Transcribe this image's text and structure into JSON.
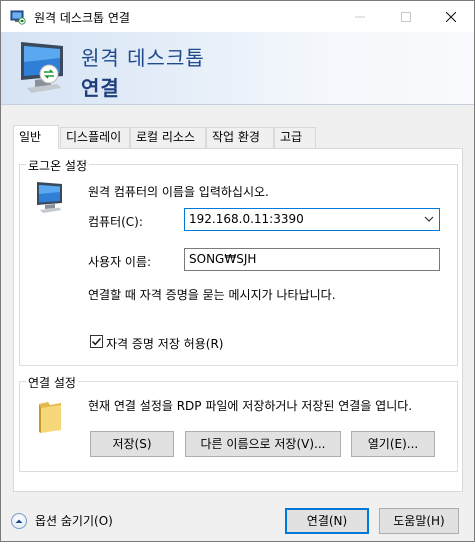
{
  "window": {
    "title": "원격 데스크톱 연결"
  },
  "banner": {
    "title": "원격 데스크톱",
    "subtitle": "연결"
  },
  "tabs": [
    {
      "label": "일반",
      "active": true
    },
    {
      "label": "디스플레이",
      "active": false
    },
    {
      "label": "로컬 리소스",
      "active": false
    },
    {
      "label": "작업 환경",
      "active": false
    },
    {
      "label": "고급",
      "active": false
    }
  ],
  "logon": {
    "group_label": "로그온 설정",
    "instruction": "원격 컴퓨터의 이름을 입력하십시오.",
    "computer_label": "컴퓨터(C):",
    "computer_value": "192.168.0.11:3390",
    "username_label": "사용자 이름:",
    "username_value": "SONG₩SJH",
    "prompt_note": "연결할 때 자격 증명을 묻는 메시지가 나타납니다.",
    "save_credentials_label": "자격 증명 저장 허용(R)",
    "save_credentials_checked": true
  },
  "connection": {
    "group_label": "연결 설정",
    "description": "현재 연결 설정을 RDP 파일에 저장하거나 저장된 연결을 엽니다.",
    "save_label": "저장(S)",
    "save_as_label": "다른 이름으로 저장(V)...",
    "open_label": "열기(E)..."
  },
  "footer": {
    "hide_options_label": "옵션 숨기기(O)",
    "connect_label": "연결(N)",
    "help_label": "도움말(H)"
  },
  "colors": {
    "accent": "#0078d7",
    "banner_text": "#1f4a8c"
  }
}
